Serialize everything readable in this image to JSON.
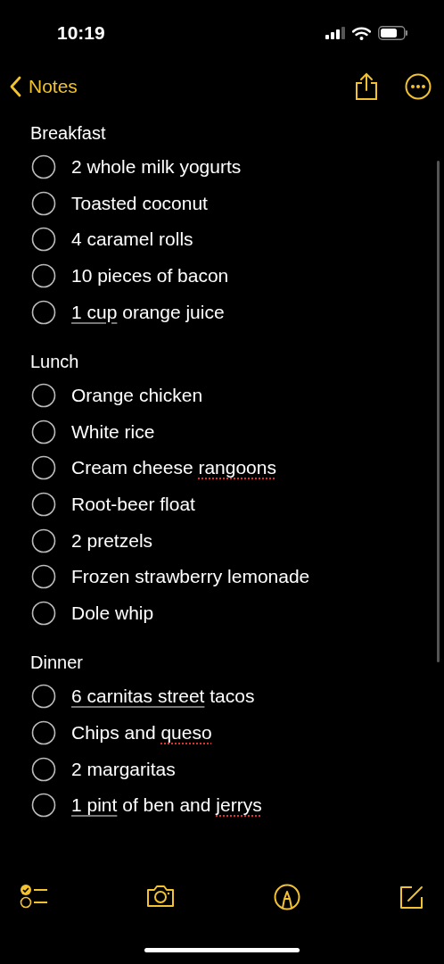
{
  "status_bar": {
    "time": "10:19"
  },
  "nav": {
    "back_label": "Notes"
  },
  "sections": [
    {
      "title": "Breakfast",
      "items": [
        {
          "checked": false,
          "segments": [
            {
              "text": "2 whole milk yogurts",
              "kind": "plain"
            }
          ]
        },
        {
          "checked": false,
          "segments": [
            {
              "text": "Toasted coconut",
              "kind": "plain"
            }
          ]
        },
        {
          "checked": false,
          "segments": [
            {
              "text": "4 caramel rolls",
              "kind": "plain"
            }
          ]
        },
        {
          "checked": false,
          "segments": [
            {
              "text": "10 pieces of bacon",
              "kind": "plain"
            }
          ]
        },
        {
          "checked": false,
          "segments": [
            {
              "text": "1 cup",
              "kind": "detected"
            },
            {
              "text": " orange juice",
              "kind": "plain"
            }
          ]
        }
      ]
    },
    {
      "title": "Lunch",
      "items": [
        {
          "checked": false,
          "segments": [
            {
              "text": "Orange chicken",
              "kind": "plain"
            }
          ]
        },
        {
          "checked": false,
          "segments": [
            {
              "text": "White rice",
              "kind": "plain"
            }
          ]
        },
        {
          "checked": false,
          "segments": [
            {
              "text": "Cream cheese ",
              "kind": "plain"
            },
            {
              "text": "rangoons",
              "kind": "misspelled"
            }
          ]
        },
        {
          "checked": false,
          "segments": [
            {
              "text": "Root-beer float",
              "kind": "plain"
            }
          ]
        },
        {
          "checked": false,
          "segments": [
            {
              "text": "2 pretzels",
              "kind": "plain"
            }
          ]
        },
        {
          "checked": false,
          "segments": [
            {
              "text": "Frozen strawberry lemonade",
              "kind": "plain"
            }
          ]
        },
        {
          "checked": false,
          "segments": [
            {
              "text": "Dole whip",
              "kind": "plain"
            }
          ]
        }
      ]
    },
    {
      "title": "Dinner",
      "items": [
        {
          "checked": false,
          "segments": [
            {
              "text": "6 carnitas street",
              "kind": "detected"
            },
            {
              "text": " tacos",
              "kind": "plain"
            }
          ]
        },
        {
          "checked": false,
          "segments": [
            {
              "text": "Chips and ",
              "kind": "plain"
            },
            {
              "text": "queso",
              "kind": "misspelled"
            }
          ]
        },
        {
          "checked": false,
          "segments": [
            {
              "text": "2 margaritas",
              "kind": "plain"
            }
          ]
        },
        {
          "checked": false,
          "segments": [
            {
              "text": "1 pint",
              "kind": "detected"
            },
            {
              "text": " of ben and ",
              "kind": "plain"
            },
            {
              "text": "jerrys",
              "kind": "misspelled"
            }
          ]
        }
      ]
    }
  ]
}
